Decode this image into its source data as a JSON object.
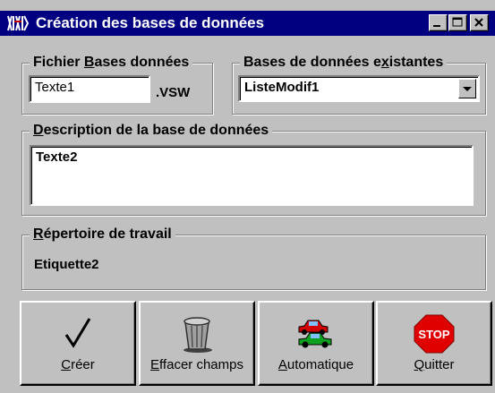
{
  "window": {
    "title": "Création des bases de données"
  },
  "fichier": {
    "legend_pre": "Fichier ",
    "legend_key": "B",
    "legend_post": "ases données",
    "value": "Texte1",
    "extension": ".VSW"
  },
  "bases": {
    "legend_pre": "Bases de données e",
    "legend_key": "x",
    "legend_post": "istantes",
    "selected": "ListeModif1"
  },
  "description": {
    "legend_key": "D",
    "legend_post": "escription de la base de données",
    "value": "Texte2"
  },
  "repertoire": {
    "legend_key": "R",
    "legend_post": "épertoire de travail",
    "value": "Etiquette2"
  },
  "buttons": {
    "creer": {
      "key": "C",
      "rest": "réer",
      "icon": "checkmark-icon"
    },
    "effacer": {
      "key": "E",
      "rest": "ffacer champs",
      "icon": "trash-can-icon"
    },
    "automatique": {
      "key": "A",
      "rest": "utomatique",
      "icon": "cars-icon"
    },
    "quitter": {
      "key": "Q",
      "rest": "uitter",
      "icon": "stop-sign-icon",
      "stop_text": "STOP"
    }
  },
  "colors": {
    "titlebar": "#000080",
    "face": "#c0c0c0",
    "stop": "#e00000"
  }
}
